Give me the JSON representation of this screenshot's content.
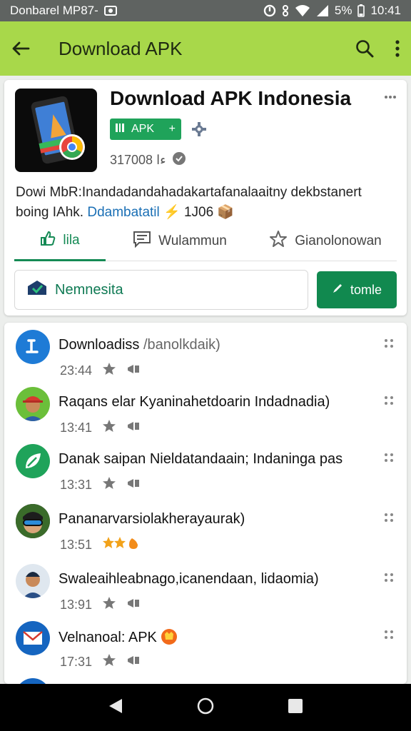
{
  "status_bar": {
    "left_text": "Donbarel MP87-",
    "battery": "5%",
    "time": "10:41"
  },
  "app_bar": {
    "title": "Download APK"
  },
  "app": {
    "title": "Download APK Indonesia",
    "badge_label": "APK",
    "stats": "3170ءا 08",
    "description_line1": "Dowi MbR:Inandadandahadakartafanalaaitny dekbstanert",
    "description_line2_prefix": "boing IAhk. ",
    "description_link": "Ddambatatil",
    "description_tail": "⚡ 1J06 📦"
  },
  "tabs": [
    {
      "label": "lila"
    },
    {
      "label": "Wulammun"
    },
    {
      "label": "Gianolonowan"
    }
  ],
  "name_field": {
    "value": "Nemnesita"
  },
  "action_button": {
    "label": "tomle"
  },
  "list": [
    {
      "title": "Downloadiss",
      "subtitle": "/banolkdaik)",
      "time": "23:44",
      "avatar_icon": "download-icon",
      "avatar_color": "#1e7bd6"
    },
    {
      "title": "Raqans elar Kyaninahetdoarin Indadnadia)",
      "subtitle": "",
      "time": "13:41",
      "avatar_icon": "cap-person-avatar",
      "avatar_color": "#6bbf3a"
    },
    {
      "title": "Danak saipan Nieldatandaain; Indaninga pas",
      "subtitle": "",
      "time": "13:31",
      "avatar_icon": "leaf-icon",
      "avatar_color": "#1fa35a"
    },
    {
      "title": "Pananarvarsiolakherayaurak)",
      "subtitle": "",
      "time": "13:51",
      "avatar_icon": "goggles-person-avatar",
      "avatar_color": "#2e2e2e"
    },
    {
      "title": "Swaleaihleabnago,icanendaan, lidaomia)",
      "subtitle": "",
      "time": "13:91",
      "avatar_icon": "boy-avatar",
      "avatar_color": "#dfe7ef"
    },
    {
      "title": "Velnanoal: APK",
      "subtitle": "",
      "time": "17:31",
      "avatar_icon": "mail-icon",
      "avatar_color": "#1565c0"
    }
  ],
  "colors": {
    "app_bar": "#a8d84a",
    "accent_green": "#11894f",
    "status_bar": "#5f6361"
  }
}
